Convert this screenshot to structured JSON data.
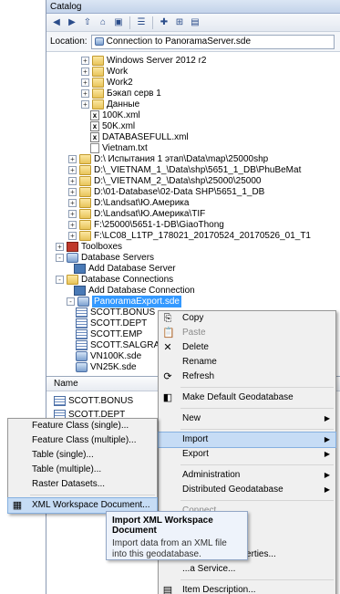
{
  "window": {
    "title": "Catalog"
  },
  "location": {
    "label": "Location:",
    "value": "Connection to PanoramaServer.sde"
  },
  "toolbar": {
    "icons": [
      "back-icon",
      "forward-icon",
      "up-folder-icon",
      "home-icon",
      "connect-folder-icon",
      "view-options-icon",
      "new-folder-icon",
      "toggle-tree-icon",
      "properties-icon"
    ]
  },
  "tree": [
    {
      "label": "Windows Server 2012 r2",
      "type": "folder",
      "expander": "+"
    },
    {
      "label": "Work",
      "type": "folder",
      "expander": "+"
    },
    {
      "label": "Work2",
      "type": "folder",
      "expander": "+"
    },
    {
      "label": "Бэкап серв 1",
      "type": "folder",
      "expander": "+"
    },
    {
      "label": "Данные",
      "type": "folder",
      "expander": "+"
    },
    {
      "label": "100K.xml",
      "type": "xml"
    },
    {
      "label": "50K.xml",
      "type": "xml"
    },
    {
      "label": "DATABASEFULL.xml",
      "type": "xml"
    },
    {
      "label": "Vietnam.txt",
      "type": "txt"
    },
    {
      "label": "D:\\    Испытания 1 этап\\Data\\map\\25000shp",
      "type": "folder",
      "expander": "+"
    },
    {
      "label": "D:\\_VIETNAM_1_\\Data\\shp\\5651_1_DB\\PhuBeMat",
      "type": "folder",
      "expander": "+"
    },
    {
      "label": "D:\\_VIETNAM_2_\\Data\\shp\\25000\\25000",
      "type": "folder",
      "expander": "+"
    },
    {
      "label": "D:\\01-Database\\02-Data SHP\\5651_1_DB",
      "type": "folder",
      "expander": "+"
    },
    {
      "label": "D:\\Landsat\\Ю.Америка",
      "type": "folder",
      "expander": "+"
    },
    {
      "label": "D:\\Landsat\\Ю.Америка\\TIF",
      "type": "folder",
      "expander": "+"
    },
    {
      "label": "F:\\25000\\5651-1-DB\\GiaoThong",
      "type": "folder",
      "expander": "+"
    },
    {
      "label": "F:\\LC08_L1TP_178021_20170524_20170526_01_T1",
      "type": "folder",
      "expander": "+"
    },
    {
      "label": "Toolboxes",
      "type": "toolbox",
      "expander": "+"
    },
    {
      "label": "Database Servers",
      "type": "server",
      "expander": "-"
    },
    {
      "label": "Add Database Server",
      "type": "addserver"
    },
    {
      "label": "Database Connections",
      "type": "folder",
      "expander": "-"
    },
    {
      "label": "Add Database Connection",
      "type": "addserver"
    },
    {
      "label": "PanoramaExport.sde",
      "type": "db",
      "expander": "-",
      "selected": true
    },
    {
      "label": "SCOTT.BONUS",
      "type": "table"
    },
    {
      "label": "SCOTT.DEPT",
      "type": "table"
    },
    {
      "label": "SCOTT.EMP",
      "type": "table"
    },
    {
      "label": "SCOTT.SALGRADE",
      "type": "table"
    },
    {
      "label": "VN100K.sde",
      "type": "db"
    },
    {
      "label": "VN25K.sde",
      "type": "db"
    }
  ],
  "contents": {
    "header": "Name",
    "items": [
      "SCOTT.BONUS",
      "SCOTT.DEPT"
    ]
  },
  "context_menu": {
    "items": [
      {
        "label": "Copy",
        "icon": "copy-icon"
      },
      {
        "label": "Paste",
        "icon": "paste-icon",
        "disabled": true
      },
      {
        "label": "Delete",
        "icon": "delete-icon"
      },
      {
        "label": "Rename",
        "icon": ""
      },
      {
        "label": "Refresh",
        "icon": "refresh-icon"
      },
      {
        "sep": true
      },
      {
        "label": "Make Default Geodatabase",
        "icon": "default-gdb-icon"
      },
      {
        "sep": true
      },
      {
        "label": "New",
        "submenu": true
      },
      {
        "sep": true
      },
      {
        "label": "Import",
        "submenu": true,
        "highlighted": true
      },
      {
        "label": "Export",
        "submenu": true
      },
      {
        "sep": true
      },
      {
        "label": "Administration",
        "submenu": true
      },
      {
        "label": "Distributed Geodatabase",
        "submenu": true
      },
      {
        "sep": true
      },
      {
        "label": "Connect",
        "disabled": true
      },
      {
        "label": "Disconnect"
      },
      {
        "label": "...roperties..."
      },
      {
        "label": "...nnection Properties..."
      },
      {
        "label": "...a Service..."
      },
      {
        "sep": true
      },
      {
        "label": "Item Description...",
        "icon": "item-description-icon"
      },
      {
        "label": "Properties...",
        "icon": "properties-icon"
      }
    ]
  },
  "import_submenu": {
    "items": [
      {
        "label": "Feature Class (single)..."
      },
      {
        "label": "Feature Class (multiple)..."
      },
      {
        "label": "Table (single)..."
      },
      {
        "label": "Table (multiple)..."
      },
      {
        "label": "Raster Datasets..."
      },
      {
        "sep": true
      },
      {
        "label": "XML Workspace Document...",
        "highlighted": true,
        "icon": "xml-workspace-icon"
      }
    ]
  },
  "tooltip": {
    "title": "Import XML Workspace Document",
    "description": "Import data from an XML file into this geodatabase."
  }
}
